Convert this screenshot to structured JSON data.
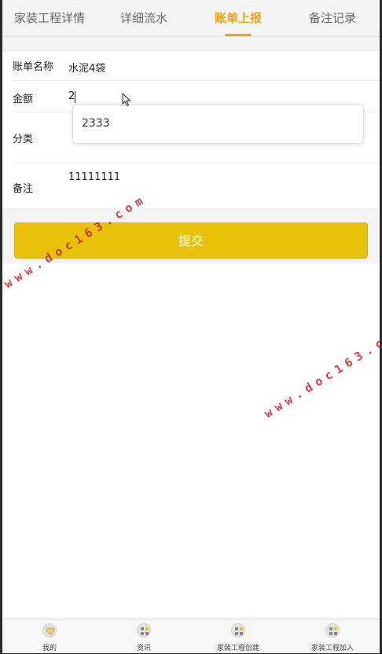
{
  "tabs": [
    {
      "label": "家装工程详情"
    },
    {
      "label": "详细流水"
    },
    {
      "label": "账单上报"
    },
    {
      "label": "备注记录"
    }
  ],
  "active_tab": "账单上报",
  "form": {
    "bill_name": {
      "label": "账单名称",
      "value": "水泥4袋"
    },
    "amount": {
      "label": "金额",
      "value": "2"
    },
    "category": {
      "label": "分类",
      "value": ""
    },
    "remark": {
      "label": "备注",
      "value": "11111111"
    }
  },
  "autocomplete": {
    "suggestions": [
      "2333"
    ]
  },
  "submit_label": "提交",
  "watermark": "www.doc163.com",
  "bottom_nav": [
    {
      "label": "我的",
      "icon": "heart-icon"
    },
    {
      "label": "资讯",
      "icon": "grid-icon"
    },
    {
      "label": "家装工程创建",
      "icon": "grid-icon"
    },
    {
      "label": "家装工程加入",
      "icon": "grid-icon"
    }
  ],
  "colors": {
    "accent": "#f0a020",
    "submit": "#e8c10a",
    "watermark": "#c6202a"
  }
}
